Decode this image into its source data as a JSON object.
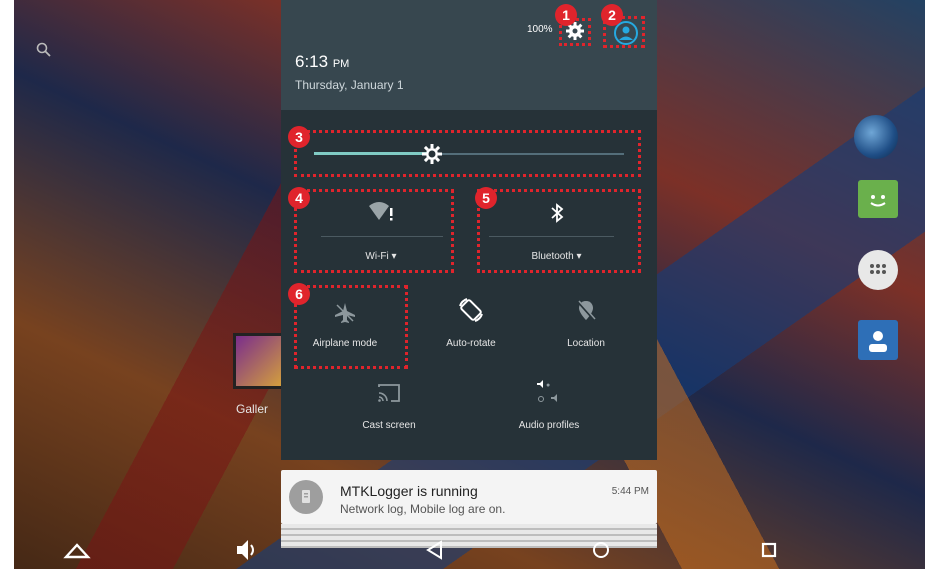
{
  "status": {
    "battery": "100%",
    "time_main": "6:13",
    "time_suffix": "PM",
    "date": "Thursday, January 1"
  },
  "brightness": {
    "level_fraction": 0.38
  },
  "tiles": {
    "wifi": {
      "label": "Wi-Fi",
      "icon": "wifi-alert-icon"
    },
    "bluetooth": {
      "label": "Bluetooth",
      "icon": "bluetooth-icon"
    },
    "airplane": {
      "label": "Airplane mode",
      "icon": "airplane-icon"
    },
    "autorotate": {
      "label": "Auto-rotate",
      "icon": "rotate-icon"
    },
    "location": {
      "label": "Location",
      "icon": "location-off-icon"
    },
    "cast": {
      "label": "Cast screen",
      "icon": "cast-icon"
    },
    "audio": {
      "label": "Audio profiles",
      "icon": "audio-profiles-icon"
    }
  },
  "annotations": [
    "1",
    "2",
    "3",
    "4",
    "5",
    "6"
  ],
  "notification": {
    "title": "MTKLogger is running",
    "text": "Network log, Mobile log are on.",
    "time": "5:44 PM"
  },
  "desktop": {
    "gallery_label": "Galler"
  },
  "colors": {
    "accent": "#80cbc4",
    "annotation_red": "#e0242c",
    "shade_bg": "#263238"
  }
}
